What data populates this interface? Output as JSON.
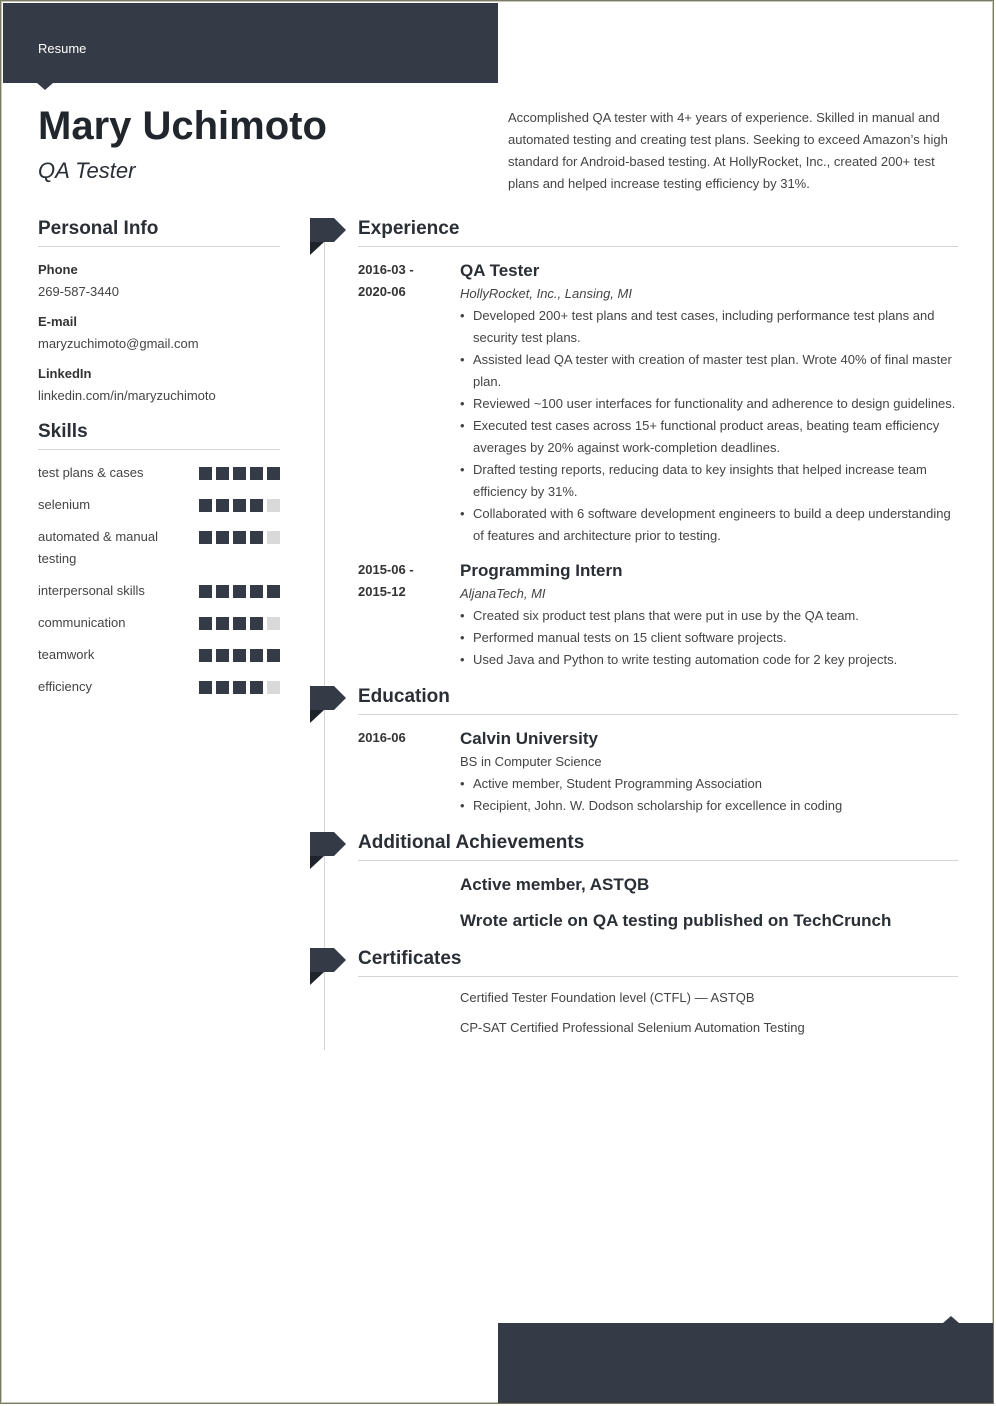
{
  "banner": {
    "label": "Resume"
  },
  "header": {
    "name": "Mary Uchimoto",
    "role": "QA Tester",
    "summary": "Accomplished QA tester with 4+ years of experience. Skilled in manual and automated testing and creating test plans. Seeking to exceed Amazon’s high standard for Android-based testing. At HollyRocket, Inc., created 200+ test plans and helped increase testing efficiency by 31%."
  },
  "personal_info": {
    "heading": "Personal Info",
    "items": [
      {
        "label": "Phone",
        "value": "269-587-3440"
      },
      {
        "label": "E-mail",
        "value": "maryzuchimoto@gmail.com"
      },
      {
        "label": "LinkedIn",
        "value": "linkedin.com/in/maryzuchimoto"
      }
    ]
  },
  "skills": {
    "heading": "Skills",
    "max_level": 5,
    "items": [
      {
        "name": "test plans & cases",
        "level": 5
      },
      {
        "name": "selenium",
        "level": 4
      },
      {
        "name": "automated & manual testing",
        "level": 4
      },
      {
        "name": "interpersonal skills",
        "level": 5
      },
      {
        "name": "communication",
        "level": 4
      },
      {
        "name": "teamwork",
        "level": 5
      },
      {
        "name": "efficiency",
        "level": 4
      }
    ]
  },
  "experience": {
    "heading": "Experience",
    "jobs": [
      {
        "date_start": "2016-03 -",
        "date_end": "2020-06",
        "title": "QA Tester",
        "company": "HollyRocket, Inc., Lansing, MI",
        "bullets": [
          "Developed 200+ test plans and test cases, including performance test plans and security test plans.",
          "Assisted lead QA tester with creation of master test plan. Wrote 40% of final master plan.",
          "Reviewed ~100 user interfaces for functionality and adherence to design guidelines.",
          "Executed test cases across 15+ functional product areas, beating team efficiency averages by 20% against work-completion deadlines.",
          "Drafted testing reports, reducing data to key insights that helped increase team efficiency by 31%.",
          "Collaborated with 6 software development engineers to build a deep understanding of features and architecture prior to testing."
        ]
      },
      {
        "date_start": "2015-06 -",
        "date_end": "2015-12",
        "title": "Programming Intern",
        "company": "AljanaTech, MI",
        "bullets": [
          "Created six product test plans that were put in use by the QA team.",
          "Performed manual tests on 15 client software projects.",
          "Used Java and Python to write testing automation code for 2 key projects."
        ]
      }
    ]
  },
  "education": {
    "heading": "Education",
    "date": "2016-06",
    "school": "Calvin University",
    "degree": "BS in Computer Science",
    "bullets": [
      "Active member, Student Programming Association",
      "Recipient, John. W. Dodson scholarship for excellence in coding"
    ]
  },
  "achievements": {
    "heading": "Additional Achievements",
    "items": [
      "Active member, ASTQB",
      "Wrote article on QA testing published on TechCrunch"
    ]
  },
  "certificates": {
    "heading": "Certificates",
    "items": [
      "Certified Tester Foundation level (CTFL) — ASTQB",
      "CP-SAT Certified Professional Selenium Automation Testing"
    ]
  },
  "colors": {
    "accent": "#343a46",
    "dot_off": "#d9d9d9",
    "divider": "#d4d4d4"
  }
}
